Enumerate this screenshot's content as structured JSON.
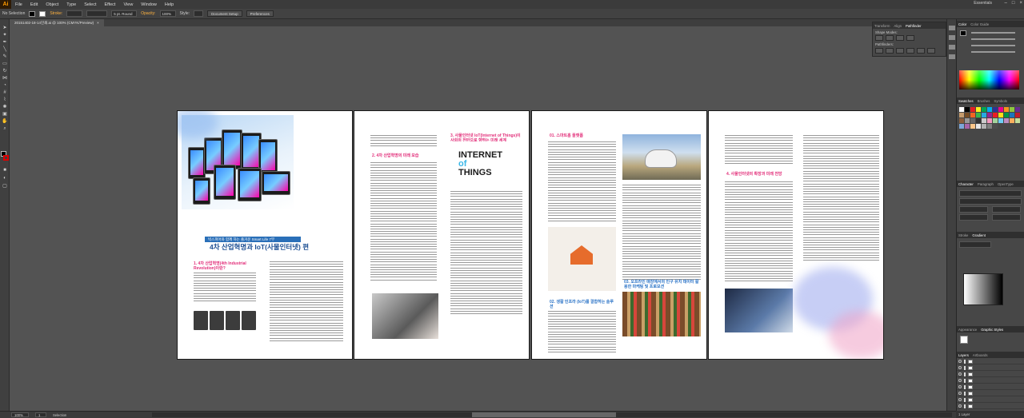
{
  "menubar": {
    "logo": "Ai",
    "items": [
      "File",
      "Edit",
      "Object",
      "Type",
      "Select",
      "Effect",
      "View",
      "Window",
      "Help"
    ],
    "workspace": "Essentials"
  },
  "control": {
    "selection_label": "No Selection",
    "stroke_label": "Stroke:",
    "stroke_profile": "5 pt. Round",
    "opacity_label": "Opacity:",
    "opacity_value": "100%",
    "style_label": "Style:",
    "doc_setup_btn": "Document Setup",
    "preferences_btn": "Preferences"
  },
  "document": {
    "tab_title": "20151402-18-14인쇄.ai @ 100% (CMYK/Preview)"
  },
  "artboard1": {
    "banner": "빅스피어와 함께 하는 즐거운 Smart Life 7부",
    "title": "4차 산업혁명과 IoT(사물인터넷) 편",
    "subhead": "1. 4차 산업혁명(4th Industrial Revolution)이란?"
  },
  "artboard2": {
    "head_top": "2. 4차 산업혁명의 미래 모습",
    "head_iot": "3. 사물인터넷 IoT(Internet of Things)이 사회의 전반으로 향하는 미래 세계",
    "iot_line1": "INTERNET",
    "iot_line2": "of",
    "iot_line3": "THINGS"
  },
  "artboard3": {
    "head_smarthome": "01. 스마트홈 플랫폼",
    "head_sensor": "02. 생활 인프라 (IoT)를 결합하는 솔루션",
    "head_retail": "03. 오프라인 매장에서의 인구 유치 데이터 활용한 마케팅 및 프로모션"
  },
  "artboard4": {
    "head_future": "4. 사물인터넷의 확장과 미래 전망"
  },
  "panels": {
    "transform_tabs": [
      "Transform",
      "Align",
      "Pathfinder"
    ],
    "shape_modes": "Shape Modes:",
    "pathfinders": "Pathfinders:",
    "color_tabs": [
      "Color",
      "Color Guide"
    ],
    "swatch_tabs": [
      "Swatches",
      "Brushes",
      "Symbols"
    ],
    "character_tabs": [
      "Character",
      "Paragraph",
      "OpenType"
    ],
    "stroke_tabs": [
      "Stroke",
      "Gradient"
    ],
    "appearance_tabs": [
      "Appearance",
      "Graphic Styles"
    ],
    "layers_tabs": [
      "Layers",
      "Artboards"
    ],
    "layers_status": "1 Layer"
  },
  "status": {
    "zoom": "100%",
    "page": "1",
    "mode": "Selection"
  }
}
